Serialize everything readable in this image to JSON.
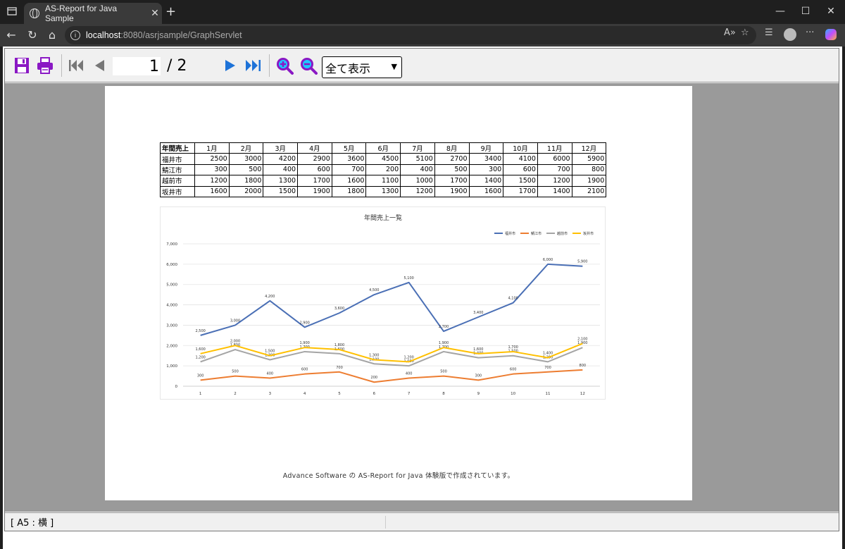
{
  "browser": {
    "tab_title": "AS-Report for Java Sample",
    "url_host": "localhost",
    "url_rest": ":8080/asrjsample/GraphServlet"
  },
  "viewer": {
    "current_page": "1",
    "total_pages": "/ 2",
    "zoom_value": "全て表示",
    "status": "[ A5 : 横 ]"
  },
  "report": {
    "table": {
      "corner": "年間売上",
      "months": [
        "1月",
        "2月",
        "3月",
        "4月",
        "5月",
        "6月",
        "7月",
        "8月",
        "9月",
        "10月",
        "11月",
        "12月"
      ],
      "rows": [
        {
          "name": "福井市",
          "values": [
            "2500",
            "3000",
            "4200",
            "2900",
            "3600",
            "4500",
            "5100",
            "2700",
            "3400",
            "4100",
            "6000",
            "5900"
          ]
        },
        {
          "name": "鯖江市",
          "values": [
            "300",
            "500",
            "400",
            "600",
            "700",
            "200",
            "400",
            "500",
            "300",
            "600",
            "700",
            "800"
          ]
        },
        {
          "name": "越前市",
          "values": [
            "1200",
            "1800",
            "1300",
            "1700",
            "1600",
            "1100",
            "1000",
            "1700",
            "1400",
            "1500",
            "1200",
            "1900"
          ]
        },
        {
          "name": "坂井市",
          "values": [
            "1600",
            "2000",
            "1500",
            "1900",
            "1800",
            "1300",
            "1200",
            "1900",
            "1600",
            "1700",
            "1400",
            "2100"
          ]
        }
      ]
    },
    "footer": "Advance Software の AS-Report for Java 体験版で作成されています。"
  },
  "chart_data": {
    "type": "line",
    "title": "年間売上一覧",
    "x": [
      "1",
      "2",
      "3",
      "4",
      "5",
      "6",
      "7",
      "8",
      "9",
      "10",
      "11",
      "12"
    ],
    "ylim": [
      0,
      7000
    ],
    "yticks": [
      "0",
      "1,000",
      "2,000",
      "3,000",
      "4,000",
      "5,000",
      "6,000",
      "7,000"
    ],
    "grid": true,
    "legend": "top-right",
    "series": [
      {
        "name": "福井市",
        "color": "#4a6fb5",
        "values": [
          2500,
          3000,
          4200,
          2900,
          3600,
          4500,
          5100,
          2700,
          3400,
          4100,
          6000,
          5900
        ]
      },
      {
        "name": "鯖江市",
        "color": "#ed7d31",
        "values": [
          300,
          500,
          400,
          600,
          700,
          200,
          400,
          500,
          300,
          600,
          700,
          800
        ]
      },
      {
        "name": "越前市",
        "color": "#a5a5a5",
        "values": [
          1200,
          1800,
          1300,
          1700,
          1600,
          1100,
          1000,
          1700,
          1400,
          1500,
          1200,
          1900
        ]
      },
      {
        "name": "坂井市",
        "color": "#ffc000",
        "values": [
          1600,
          2000,
          1500,
          1900,
          1800,
          1300,
          1200,
          1900,
          1600,
          1700,
          1400,
          2100
        ]
      }
    ]
  }
}
